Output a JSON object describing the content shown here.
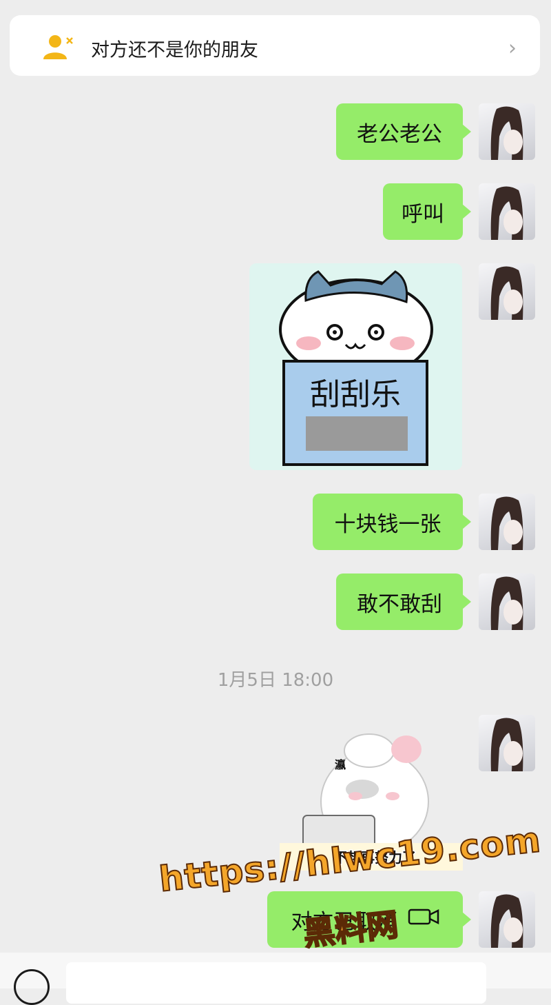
{
  "notice": {
    "text": "对方还不是你的朋友",
    "icon": "person-add-icon"
  },
  "messages": [
    {
      "type": "text",
      "text": "老公老公"
    },
    {
      "type": "text",
      "text": "呼叫"
    },
    {
      "type": "sticker",
      "text": "刮刮乐"
    },
    {
      "type": "text",
      "text": "十块钱一张"
    },
    {
      "type": "text",
      "text": "敢不敢刮"
    }
  ],
  "timestamp": "1月5日 18:00",
  "sticker2": {
    "caption": "不想再努力了",
    "tag": "瀛"
  },
  "last_call_message": {
    "text": "对方已取消",
    "icon": "video-call-icon"
  },
  "watermark": {
    "url": "https://hlwc19.com",
    "name": "黑料网"
  },
  "colors": {
    "bubble": "#95ec69",
    "background": "#ededed",
    "notice_icon": "#f3b617"
  }
}
